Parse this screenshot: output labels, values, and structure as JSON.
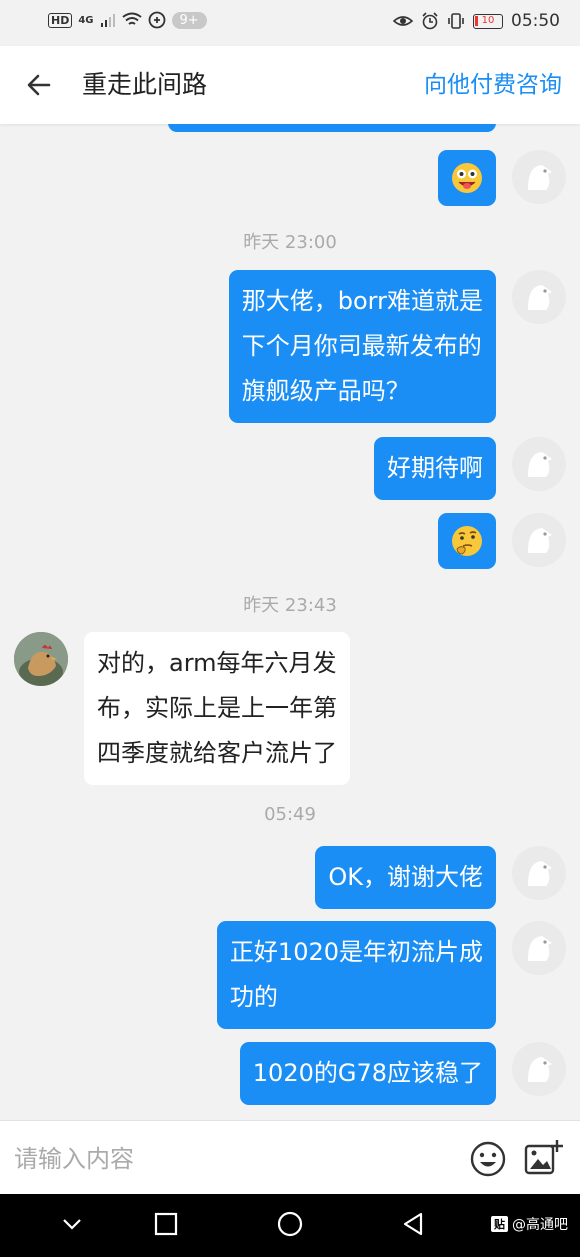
{
  "status_bar": {
    "network": "4G",
    "notification_badge": "9+",
    "battery_level": "10",
    "time": "05:50"
  },
  "nav": {
    "title": "重走此间路",
    "action": "向他付费咨询"
  },
  "messages": [
    {
      "time": "昨天 23:00"
    },
    {
      "text_lines": [
        "那大佬，borr难道就是",
        "下个月你司最新发布的",
        "旗舰级产品吗？"
      ]
    },
    {
      "text": "好期待啊"
    },
    {
      "time": "昨天 23:43"
    },
    {
      "text_lines": [
        "对的，arm每年六月发",
        "布，实际上是上一年第",
        "四季度就给客户流片了"
      ]
    },
    {
      "time": "05:49"
    },
    {
      "text": "OK，谢谢大佬"
    },
    {
      "text_lines": [
        "正好1020是年初流片成",
        "功的"
      ]
    },
    {
      "text": "1020的G78应该稳了"
    }
  ],
  "input": {
    "placeholder": "请输入内容"
  },
  "watermark": {
    "badge": "贴",
    "text": "@高通吧"
  },
  "colors": {
    "accent": "#1a8ef5",
    "bubble_in": "#ffffff",
    "background": "#f2f2f2"
  },
  "icons": {
    "back": "arrow-left-icon",
    "emoji": "smiley-icon",
    "image": "add-image-icon"
  }
}
